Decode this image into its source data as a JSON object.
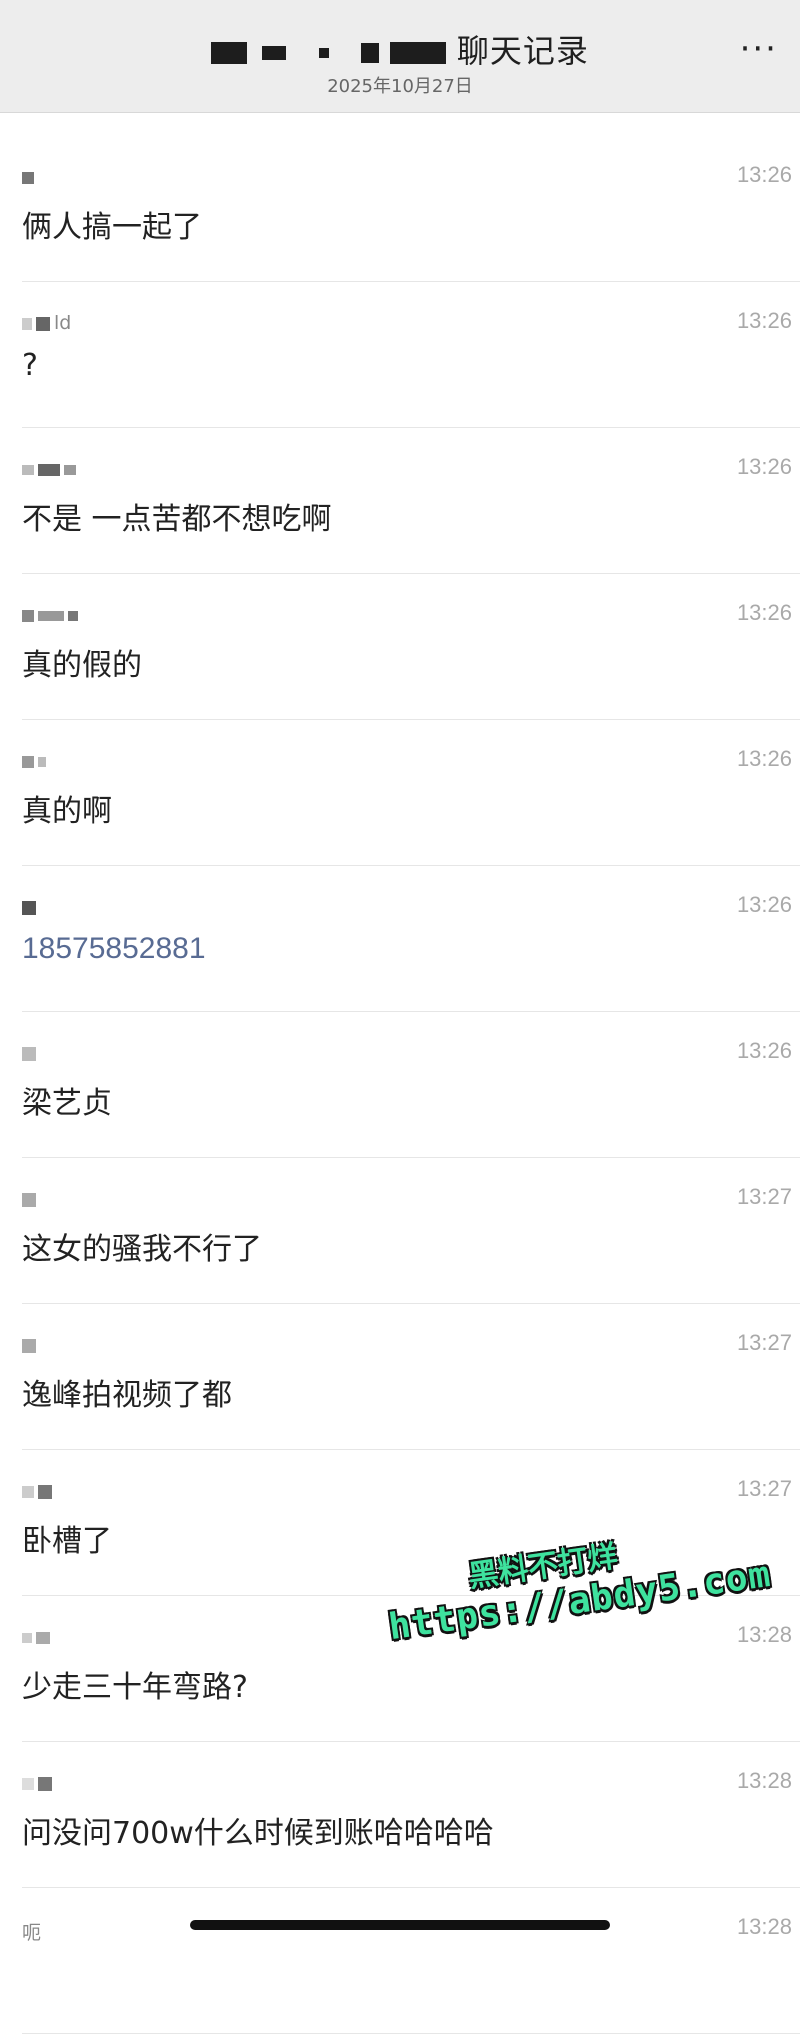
{
  "header": {
    "title_suffix": "聊天记录",
    "date": "2025年10月27日",
    "more_icon": "more-horizontal-icon",
    "more_glyph": "···"
  },
  "messages": [
    {
      "sender": "",
      "time": "13:26",
      "text": "俩人搞一起了",
      "is_link": false
    },
    {
      "sender": "ld",
      "time": "13:26",
      "text": "?",
      "is_link": false
    },
    {
      "sender": "",
      "time": "13:26",
      "text": "不是 一点苦都不想吃啊",
      "is_link": false
    },
    {
      "sender": "",
      "time": "13:26",
      "text": "真的假的",
      "is_link": false
    },
    {
      "sender": "",
      "time": "13:26",
      "text": "真的啊",
      "is_link": false
    },
    {
      "sender": "",
      "time": "13:26",
      "text": "18575852881",
      "is_link": true
    },
    {
      "sender": "",
      "time": "13:26",
      "text": "梁艺贞",
      "is_link": false
    },
    {
      "sender": "",
      "time": "13:27",
      "text": "这女的骚我不行了",
      "is_link": false
    },
    {
      "sender": "",
      "time": "13:27",
      "text": "逸峰拍视频了都",
      "is_link": false
    },
    {
      "sender": "",
      "time": "13:27",
      "text": "卧槽了",
      "is_link": false
    },
    {
      "sender": "",
      "time": "13:28",
      "text": "少走三十年弯路?",
      "is_link": false
    },
    {
      "sender": "",
      "time": "13:28",
      "text": "问没问700w什么时候到账哈哈哈哈",
      "is_link": false
    },
    {
      "sender": "呃",
      "time": "13:28",
      "text": "",
      "is_link": false
    }
  ],
  "watermark": {
    "line1": "黑料不打烊",
    "line2": "https://abdy5.com"
  },
  "colors": {
    "header_bg": "#ededed",
    "link": "#586b93",
    "timestamp": "#a9a9a9",
    "watermark": "#3ee29e"
  }
}
